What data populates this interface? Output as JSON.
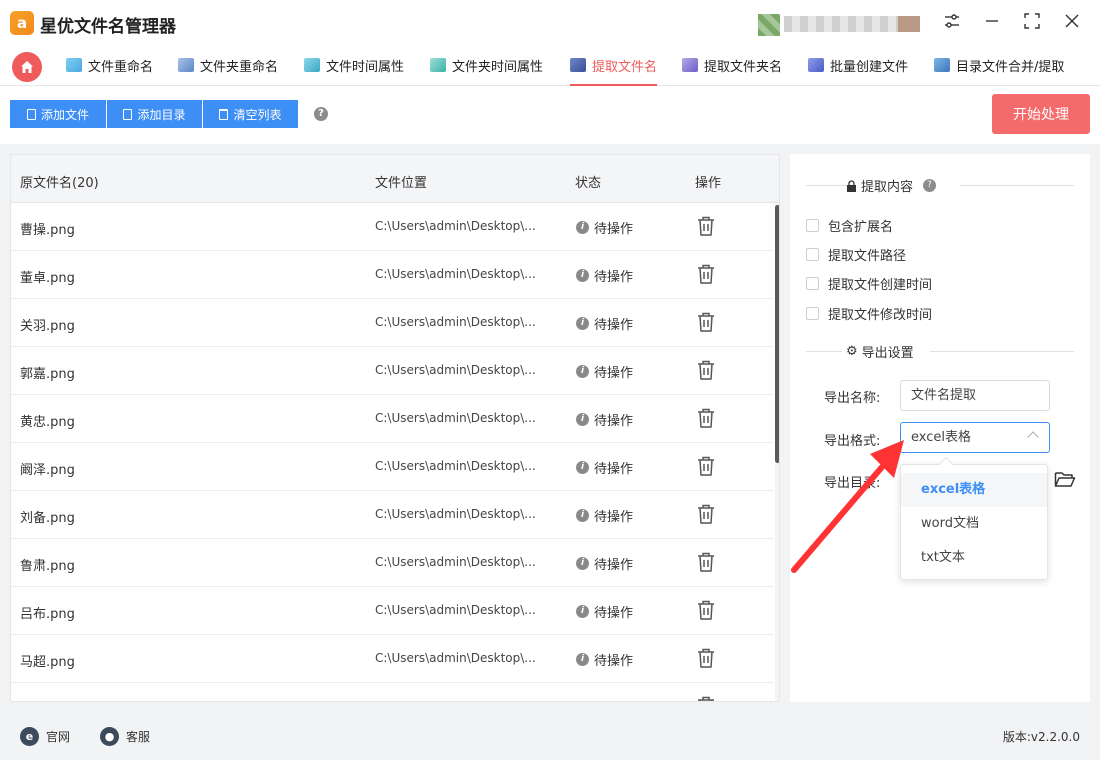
{
  "app": {
    "logo_text": "a",
    "title": "星优文件名管理器"
  },
  "window_controls": {
    "settings": "⚙",
    "minimize": "—",
    "maximize": "⛶",
    "close": "✕"
  },
  "tabs": [
    {
      "label": "文件重命名",
      "icon": "rename-file-icon",
      "active": false
    },
    {
      "label": "文件夹重命名",
      "icon": "rename-folder-icon",
      "active": false
    },
    {
      "label": "文件时间属性",
      "icon": "file-time-icon",
      "active": false
    },
    {
      "label": "文件夹时间属性",
      "icon": "folder-time-icon",
      "active": false
    },
    {
      "label": "提取文件名",
      "icon": "extract-filename-icon",
      "active": true
    },
    {
      "label": "提取文件夹名",
      "icon": "extract-foldername-icon",
      "active": false
    },
    {
      "label": "批量创建文件",
      "icon": "batch-create-icon",
      "active": false
    },
    {
      "label": "目录文件合并/提取",
      "icon": "merge-extract-icon",
      "active": false
    }
  ],
  "toolbar": {
    "add_file": "添加文件",
    "add_dir": "添加目录",
    "clear_list": "清空列表",
    "help": "?",
    "start": "开始处理"
  },
  "table": {
    "headers": {
      "name": "原文件名(20)",
      "path": "文件位置",
      "status": "状态",
      "action": "操作"
    },
    "rows": [
      {
        "name": "曹操.png",
        "path": "C:\\Users\\admin\\Desktop\\...",
        "status": "待操作"
      },
      {
        "name": "董卓.png",
        "path": "C:\\Users\\admin\\Desktop\\...",
        "status": "待操作"
      },
      {
        "name": "关羽.png",
        "path": "C:\\Users\\admin\\Desktop\\...",
        "status": "待操作"
      },
      {
        "name": "郭嘉.png",
        "path": "C:\\Users\\admin\\Desktop\\...",
        "status": "待操作"
      },
      {
        "name": "黄忠.png",
        "path": "C:\\Users\\admin\\Desktop\\...",
        "status": "待操作"
      },
      {
        "name": "阚泽.png",
        "path": "C:\\Users\\admin\\Desktop\\...",
        "status": "待操作"
      },
      {
        "name": "刘备.png",
        "path": "C:\\Users\\admin\\Desktop\\...",
        "status": "待操作"
      },
      {
        "name": "鲁肃.png",
        "path": "C:\\Users\\admin\\Desktop\\...",
        "status": "待操作"
      },
      {
        "name": "吕布.png",
        "path": "C:\\Users\\admin\\Desktop\\...",
        "status": "待操作"
      },
      {
        "name": "马超.png",
        "path": "C:\\Users\\admin\\Desktop\\...",
        "status": "待操作"
      },
      {
        "name": "",
        "path": "",
        "status": ""
      }
    ]
  },
  "settings": {
    "extract_title": "提取内容",
    "options": [
      "包含扩展名",
      "提取文件路径",
      "提取文件创建时间",
      "提取文件修改时间"
    ],
    "export_title": "导出设置",
    "name_label": "导出名称:",
    "name_value": "文件名提取",
    "format_label": "导出格式:",
    "format_value": "excel表格",
    "dir_label": "导出目录:",
    "format_options": [
      "excel表格",
      "word文档",
      "txt文本"
    ]
  },
  "statusbar": {
    "website": "官网",
    "support": "客服",
    "version": "版本:v2.2.0.0"
  },
  "colors": {
    "accent": "#3d8ef5",
    "primary_red": "#f56b6b",
    "active_tab": "#ef5a5a"
  }
}
